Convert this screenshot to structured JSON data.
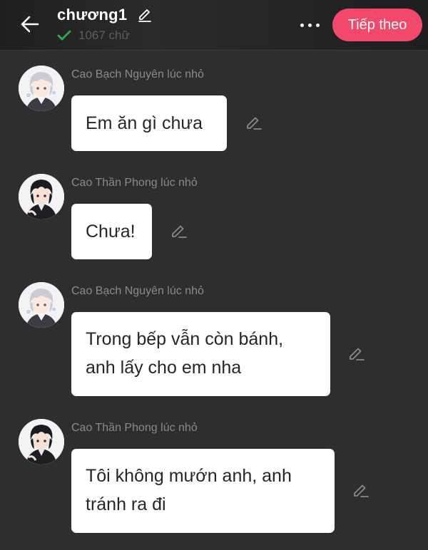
{
  "header": {
    "title": "chương1",
    "word_count": "1067 chữ",
    "next_label": "Tiếp theo",
    "icons": {
      "back": "arrow-left-icon",
      "edit": "pencil-icon",
      "check": "check-icon",
      "more": "more-dots-icon"
    },
    "colors": {
      "accent": "#f2486a",
      "check": "#2fae4e",
      "background": "#2e2e2e"
    }
  },
  "messages": [
    {
      "sender": "Cao Bạch Nguyên lúc nhỏ",
      "avatar": "light-haired-boy-avatar",
      "lines": [
        "Em ăn gì chưa"
      ]
    },
    {
      "sender": "Cao Thần Phong lúc nhỏ",
      "avatar": "dark-haired-boy-avatar",
      "lines": [
        "Chưa!"
      ]
    },
    {
      "sender": "Cao Bạch Nguyên lúc nhỏ",
      "avatar": "light-haired-boy-avatar",
      "lines": [
        "Trong bếp vẫn còn bánh,",
        "anh lấy cho em nha"
      ]
    },
    {
      "sender": "Cao Thần Phong lúc nhỏ",
      "avatar": "dark-haired-boy-avatar",
      "lines": [
        "Tôi không mướn anh, anh",
        "tránh ra đi"
      ]
    }
  ]
}
